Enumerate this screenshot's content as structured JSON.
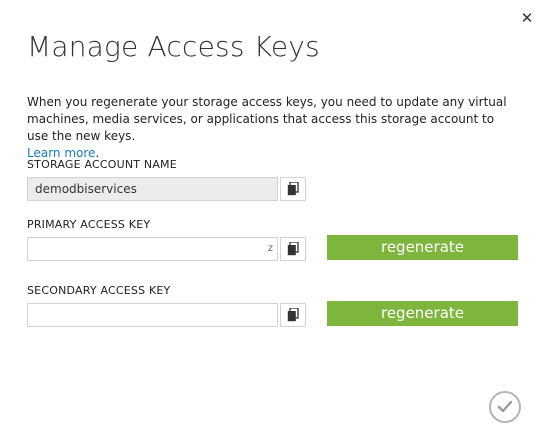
{
  "dialog": {
    "close_glyph": "✕",
    "title": "Manage Access Keys",
    "description": "When you regenerate your storage access keys, you need to update any virtual machines, media services, or applications that access this storage account to use the new keys.",
    "learn_more": "Learn more",
    "learn_more_suffix": "."
  },
  "storage_account": {
    "label": "STORAGE ACCOUNT NAME",
    "value": "demodbiservices"
  },
  "primary_key": {
    "label": "PRIMARY ACCESS KEY",
    "tail": "z",
    "regenerate_label": "regenerate"
  },
  "secondary_key": {
    "label": "SECONDARY ACCESS KEY",
    "regenerate_label": "regenerate"
  },
  "icons": {
    "copy": "copy-icon",
    "close": "close-icon",
    "ok": "checkmark-icon"
  },
  "colors": {
    "accent_green": "#7db53d",
    "link_blue": "#1a7ac4"
  }
}
